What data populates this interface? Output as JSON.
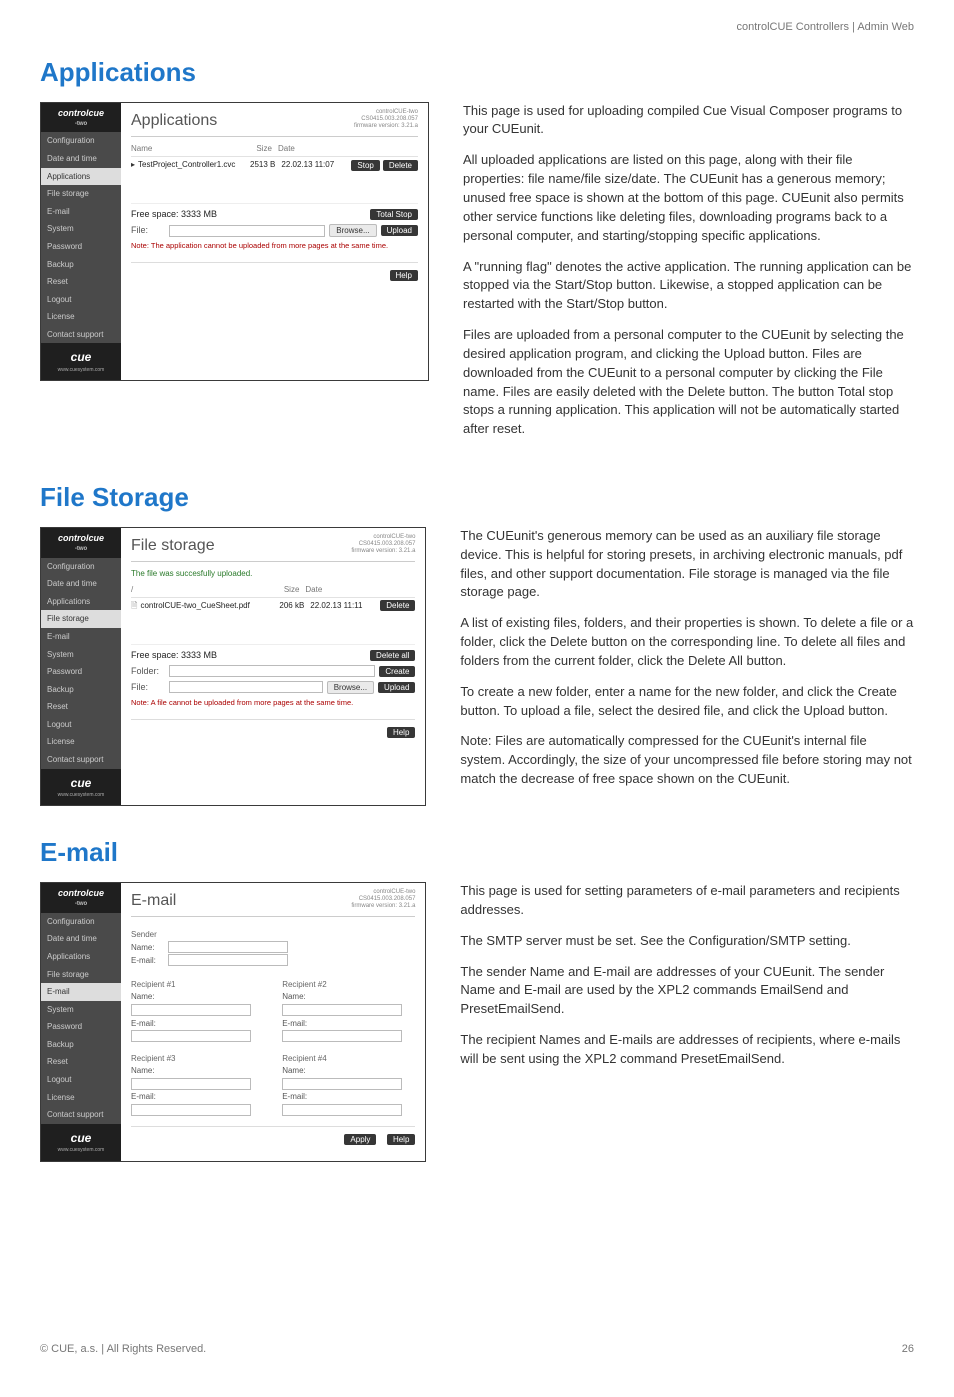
{
  "header": {
    "breadcrumb": "controlCUE Controllers | Admin Web"
  },
  "footer": {
    "copyright": "© CUE, a.s. | All Rights Reserved.",
    "page_number": "26"
  },
  "common": {
    "sidebar_items": [
      "Configuration",
      "Date and time",
      "Applications",
      "File storage",
      "E-mail",
      "System",
      "Password",
      "Backup",
      "Reset",
      "Logout",
      "License",
      "Contact support"
    ],
    "logo_text": "controlcue",
    "logo_sub": "-two",
    "footer_logo": "cue",
    "footer_url": "www.cuesystem.com",
    "meta_line1": "controlCUE-two",
    "meta_line2": "CS0415.003.208.057",
    "meta_line3": "firmware version: 3.21.a",
    "help_label": "Help"
  },
  "applications": {
    "heading": "Applications",
    "panel_title": "Applications",
    "col_name": "Name",
    "col_size": "Size",
    "col_date": "Date",
    "row_name": "TestProject_Controller1.cvc",
    "row_size": "2513 B",
    "row_date": "22.02.13 11:07",
    "btn_stop": "Stop",
    "btn_delete": "Delete",
    "free_space": "Free space: 3333 MB",
    "btn_total_stop": "Total Stop",
    "file_label": "File:",
    "btn_browse": "Browse...",
    "btn_upload": "Upload",
    "note": "Note: The application cannot be uploaded from more pages at the same time.",
    "para1": "This page is used for uploading compiled Cue Visual Composer programs to your CUEunit.",
    "para2": "All uploaded applications are listed on this page, along with their file properties: file name/file size/date. The CUEunit has a generous memory; unused free space is shown at the bottom of this page. CUEunit also permits other service functions like deleting files, downloading programs back to a personal computer, and starting/stopping specific applications.",
    "para3": "A \"running flag\" denotes the active application. The running application can be stopped via the Start/Stop button. Likewise, a stopped application can be restarted with the Start/Stop button.",
    "para4": "Files are uploaded from a personal computer to the CUEunit by selecting the desired application program, and clicking the Upload button. Files are downloaded from the CUEunit to a personal computer by clicking the File name. Files are easily deleted with the Delete button. The button Total stop stops a running application. This application will not be automatically started after reset."
  },
  "filestorage": {
    "heading": "File Storage",
    "panel_title": "File storage",
    "msg": "The file was succesfully uploaded.",
    "col_name": "/",
    "col_size": "Size",
    "col_date": "Date",
    "row_name": "controlCUE-two_CueSheet.pdf",
    "row_size": "206 kB",
    "row_date": "22.02.13 11:11",
    "btn_delete": "Delete",
    "free_space": "Free space: 3333 MB",
    "btn_delete_all": "Delete all",
    "folder_label": "Folder:",
    "file_label": "File:",
    "btn_create": "Create",
    "btn_browse": "Browse...",
    "btn_upload": "Upload",
    "note": "Note: A file cannot be uploaded from more pages at the same time.",
    "para1": "The CUEunit's generous memory can be used as an auxiliary file storage device. This is helpful for storing presets, in archiving electronic manuals, pdf files, and other support documentation. File storage is managed via the file storage page.",
    "para2": "A list of existing files, folders, and their properties is shown. To delete a file or a folder, click the Delete button on the corresponding line. To delete all files and folders from the current folder, click the Delete All button.",
    "para3": "To create a new folder, enter a name for the new folder, and click the Create button. To upload a file, select the desired file, and click the Upload button.",
    "para4": "Note: Files are automatically compressed for the CUEunit's internal file system. Accordingly, the size of your uncompressed file before storing may not match the decrease of free space shown on the CUEunit."
  },
  "email": {
    "heading": "E-mail",
    "panel_title": "E-mail",
    "sender_label": "Sender",
    "name_label": "Name:",
    "email_label": "E-mail:",
    "recipient1": "Recipient #1",
    "recipient2": "Recipient #2",
    "recipient3": "Recipient #3",
    "recipient4": "Recipient #4",
    "btn_apply": "Apply",
    "para1": "This page is used for setting parameters of e-mail parameters and recipients addresses.",
    "para2": "The SMTP server must be set. See the Configuration/SMTP setting.",
    "para3": "The sender Name and E-mail are addresses of your CUEunit. The sender Name and E-mail are used by the XPL2 commands EmailSend and PresetEmailSend.",
    "para4": "The recipient Names and E-mails are addresses of recipients, where e-mails will be sent using the XPL2 command PresetEmailSend."
  }
}
